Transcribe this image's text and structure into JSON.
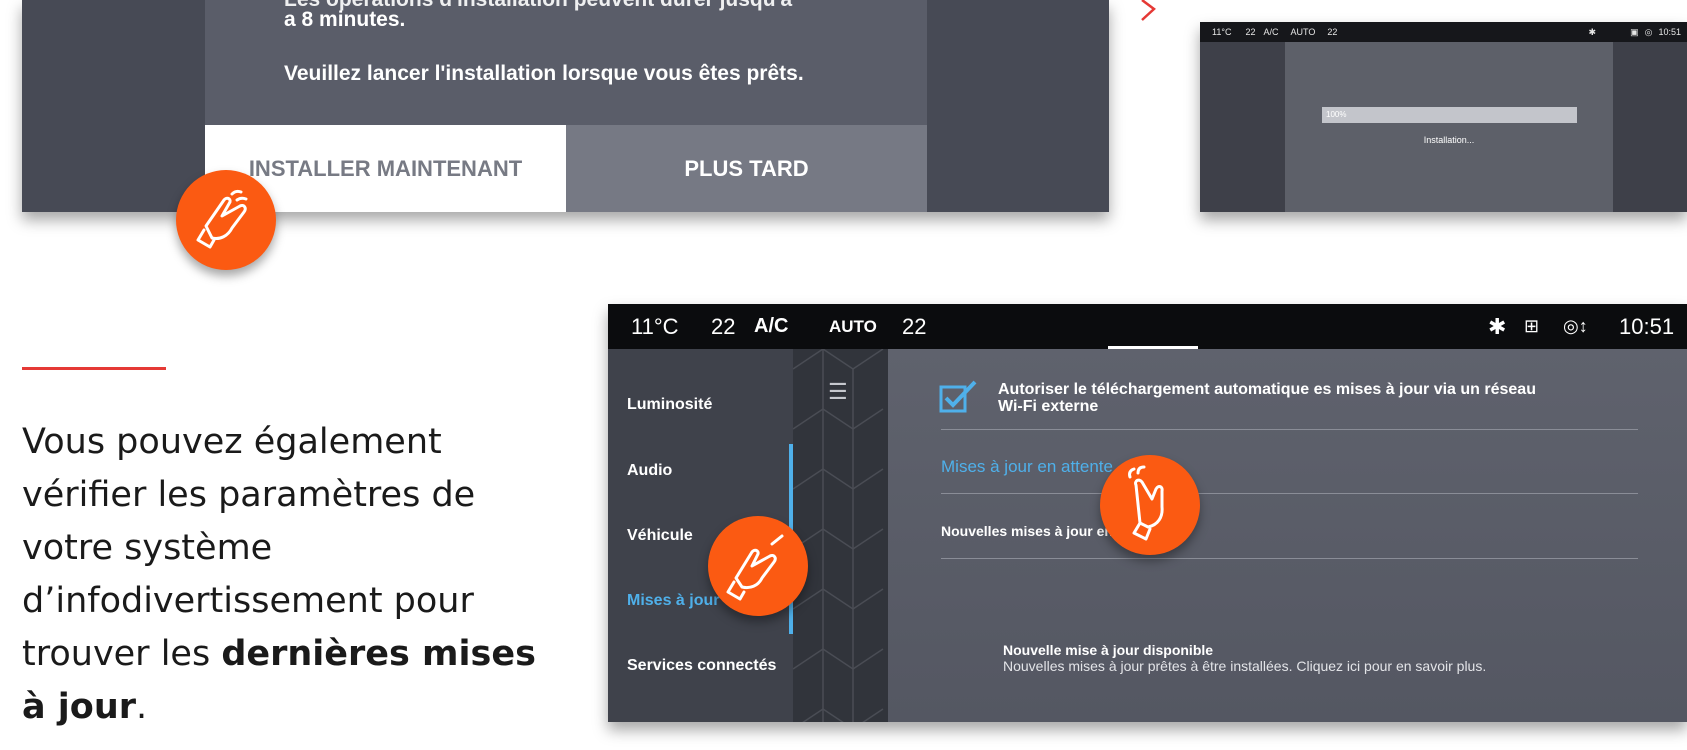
{
  "dialog": {
    "text_cut": "Les opérations d'installation peuvent durer jusqu'à",
    "line1": "a 8 minutes.",
    "line2": "Veuillez lancer l'installation lorsque vous êtes prêts.",
    "btn_install": "INSTALLER MAINTENANT",
    "btn_later": "PLUS TARD"
  },
  "install_screen": {
    "statusbar": {
      "temp": "11°C",
      "left_setting": "22",
      "ac": "A/C",
      "auto": "AUTO",
      "right_setting": "22",
      "time": "10:51"
    },
    "progress_label": "100%",
    "progress_value": 1.0,
    "status": "Installation..."
  },
  "intro_text": {
    "part1": "Vous pouvez également vérifier les paramètres de votre système d’infodivertissement pour trouver les ",
    "bold": "dernières mises à jour",
    "end": "."
  },
  "settings": {
    "statusbar": {
      "temp": "11°C",
      "left_setting": "22",
      "ac": "A/C",
      "auto": "AUTO",
      "right_setting": "22",
      "time": "10:51"
    },
    "sidebar": [
      {
        "label": "Luminosité"
      },
      {
        "label": "Audio"
      },
      {
        "label": "Véhicule"
      },
      {
        "label": "Mises à jour"
      },
      {
        "label": "Services connectés"
      }
    ],
    "checkbox_label_1": "Autoriser le téléchargement automatique es mises à jour via un réseau",
    "checkbox_label_2": "Wi-Fi externe",
    "pending_updates": "Mises à jour en attente",
    "new_updates": "Nouvelles mises à jour en",
    "notif_title": "Nouvelle mise à jour disponible",
    "notif_body": "Nouvelles mises à jour prêtes à être installées. Cliquez ici pour en savoir plus."
  },
  "colors": {
    "accent": "#fb5a12",
    "highlight_blue": "#4fb0ea",
    "divider_red": "#e53935"
  }
}
